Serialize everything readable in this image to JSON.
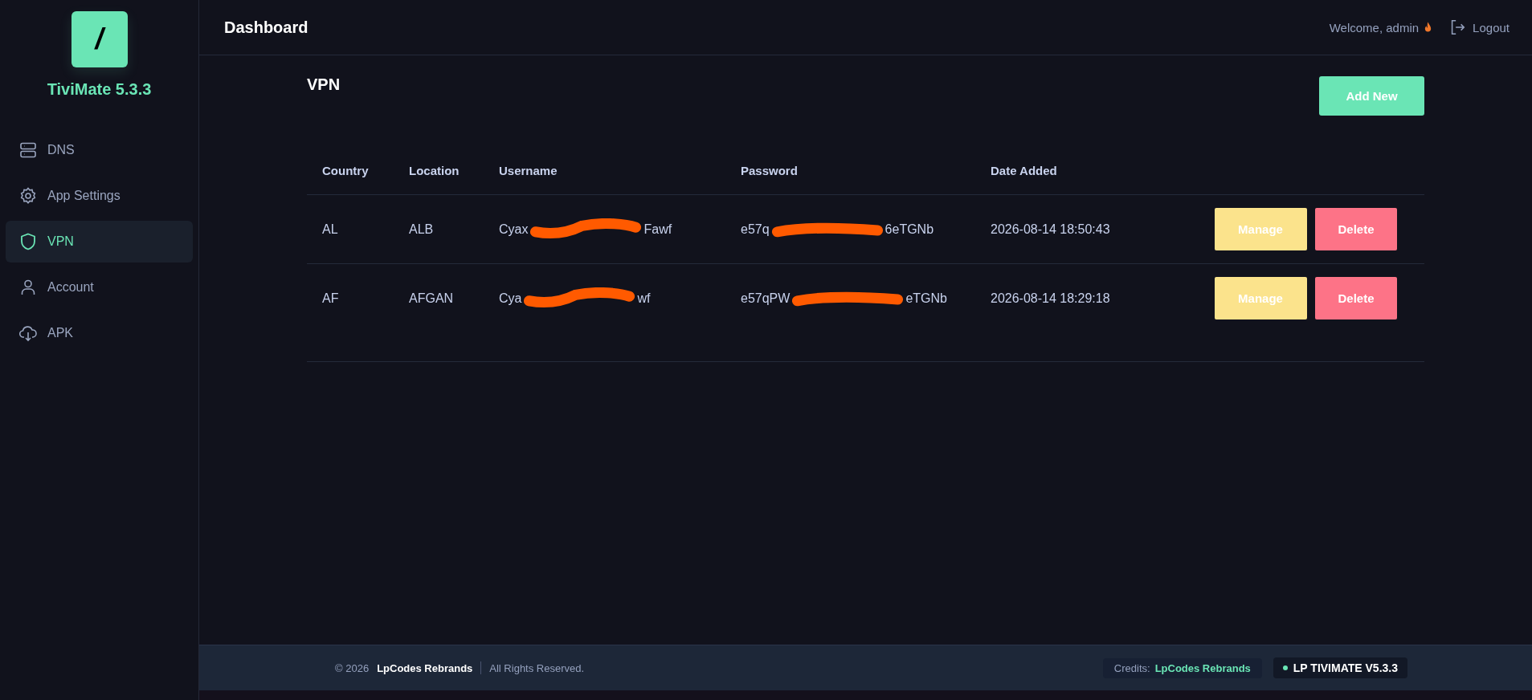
{
  "brand": {
    "logo_letter": "/",
    "name": "TiviMate 5.3.3"
  },
  "sidebar": {
    "items": [
      {
        "kind": "dns",
        "label": "DNS",
        "selected": false
      },
      {
        "kind": "settings",
        "label": "App Settings",
        "selected": false
      },
      {
        "kind": "vpn",
        "label": "VPN",
        "selected": true
      },
      {
        "kind": "account",
        "label": "Account",
        "selected": false
      },
      {
        "kind": "apk",
        "label": "APK",
        "selected": false
      }
    ]
  },
  "header": {
    "title": "Dashboard",
    "welcome": "Welcome, admin",
    "logout": "Logout"
  },
  "page": {
    "title": "VPN",
    "add_button": "Add New"
  },
  "table": {
    "columns": [
      "Country",
      "Location",
      "Username",
      "Password",
      "Date Added"
    ],
    "rows": [
      {
        "country": "AL",
        "location": "ALB",
        "username": [
          "Cyax",
          "Fawf"
        ],
        "password": [
          "e57q",
          "6eTGNb"
        ],
        "date_added": "2026-08-14 18:50:43",
        "manage": "Manage",
        "delete": "Delete"
      },
      {
        "country": "AF",
        "location": "AFGAN",
        "username": [
          "Cya",
          "wf"
        ],
        "password": [
          "e57qPW",
          "eTGNb"
        ],
        "date_added": "2026-08-14 18:29:18",
        "manage": "Manage",
        "delete": "Delete"
      }
    ]
  },
  "footer": {
    "copyright": "© 2026",
    "company": "LpCodes Rebrands",
    "rights": "All Rights Reserved.",
    "credits_label": "Credits:",
    "credits_name": "LpCodes Rebrands",
    "version": "LP TIVIMATE V5.3.3"
  }
}
